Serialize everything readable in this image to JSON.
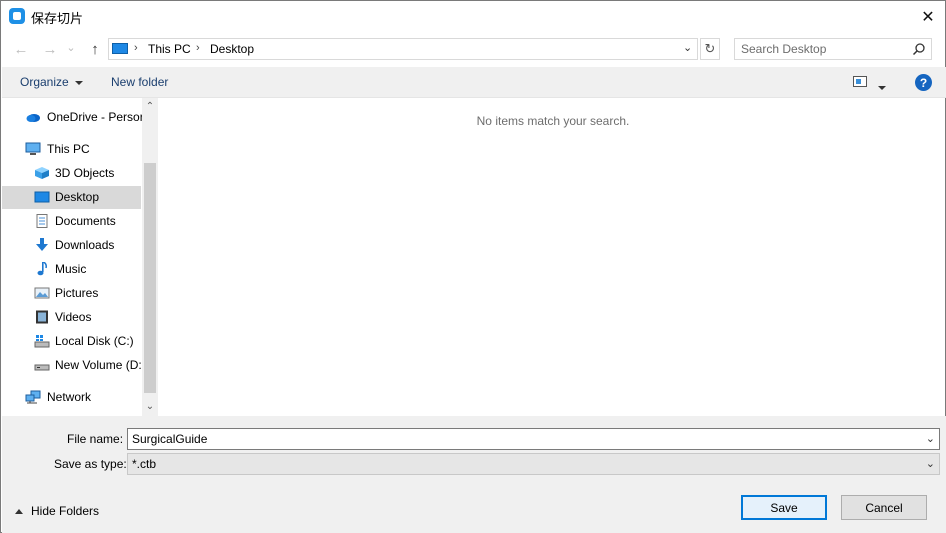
{
  "window": {
    "title": "保存切片",
    "close_glyph": "✕"
  },
  "navigation": {
    "back_glyph": "←",
    "forward_glyph": "→",
    "recent_glyph": "⌄",
    "up_glyph": "↑",
    "breadcrumb": [
      "This PC",
      "Desktop"
    ],
    "breadcrumb_separator": "›",
    "address_dropdown_glyph": "⌄",
    "refresh_glyph": "↻",
    "search_placeholder": "Search Desktop"
  },
  "command_bar": {
    "organize_label": "Organize",
    "new_folder_label": "New folder",
    "help_label": "?"
  },
  "nav_pane": {
    "items": [
      {
        "label": "OneDrive - Persor",
        "icon": "cloud-icon"
      },
      {
        "label": "This PC",
        "icon": "computer-icon"
      },
      {
        "label": "3D Objects",
        "icon": "cube-icon"
      },
      {
        "label": "Desktop",
        "icon": "desktop-icon",
        "selected": true
      },
      {
        "label": "Documents",
        "icon": "document-icon"
      },
      {
        "label": "Downloads",
        "icon": "download-icon"
      },
      {
        "label": "Music",
        "icon": "music-icon"
      },
      {
        "label": "Pictures",
        "icon": "picture-icon"
      },
      {
        "label": "Videos",
        "icon": "video-icon"
      },
      {
        "label": "Local Disk (C:)",
        "icon": "disk-icon"
      },
      {
        "label": "New Volume (D:",
        "icon": "drive-icon"
      },
      {
        "label": "Network",
        "icon": "network-icon"
      }
    ],
    "scroll_up_glyph": "⌃",
    "scroll_down_glyph": "⌄"
  },
  "content": {
    "empty_message": "No items match your search."
  },
  "form": {
    "file_name_label": "File name:",
    "file_name_value": "SurgicalGuide",
    "save_type_label": "Save as type:",
    "save_type_value": "*.ctb",
    "dropdown_glyph": "⌄"
  },
  "footer": {
    "hide_folders_label": "Hide Folders",
    "save_label": "Save",
    "cancel_label": "Cancel"
  },
  "colors": {
    "accent": "#0078d7",
    "selected_row": "#d9d9d9",
    "link_text": "#1a3e6e",
    "help_button": "#1565c0"
  }
}
